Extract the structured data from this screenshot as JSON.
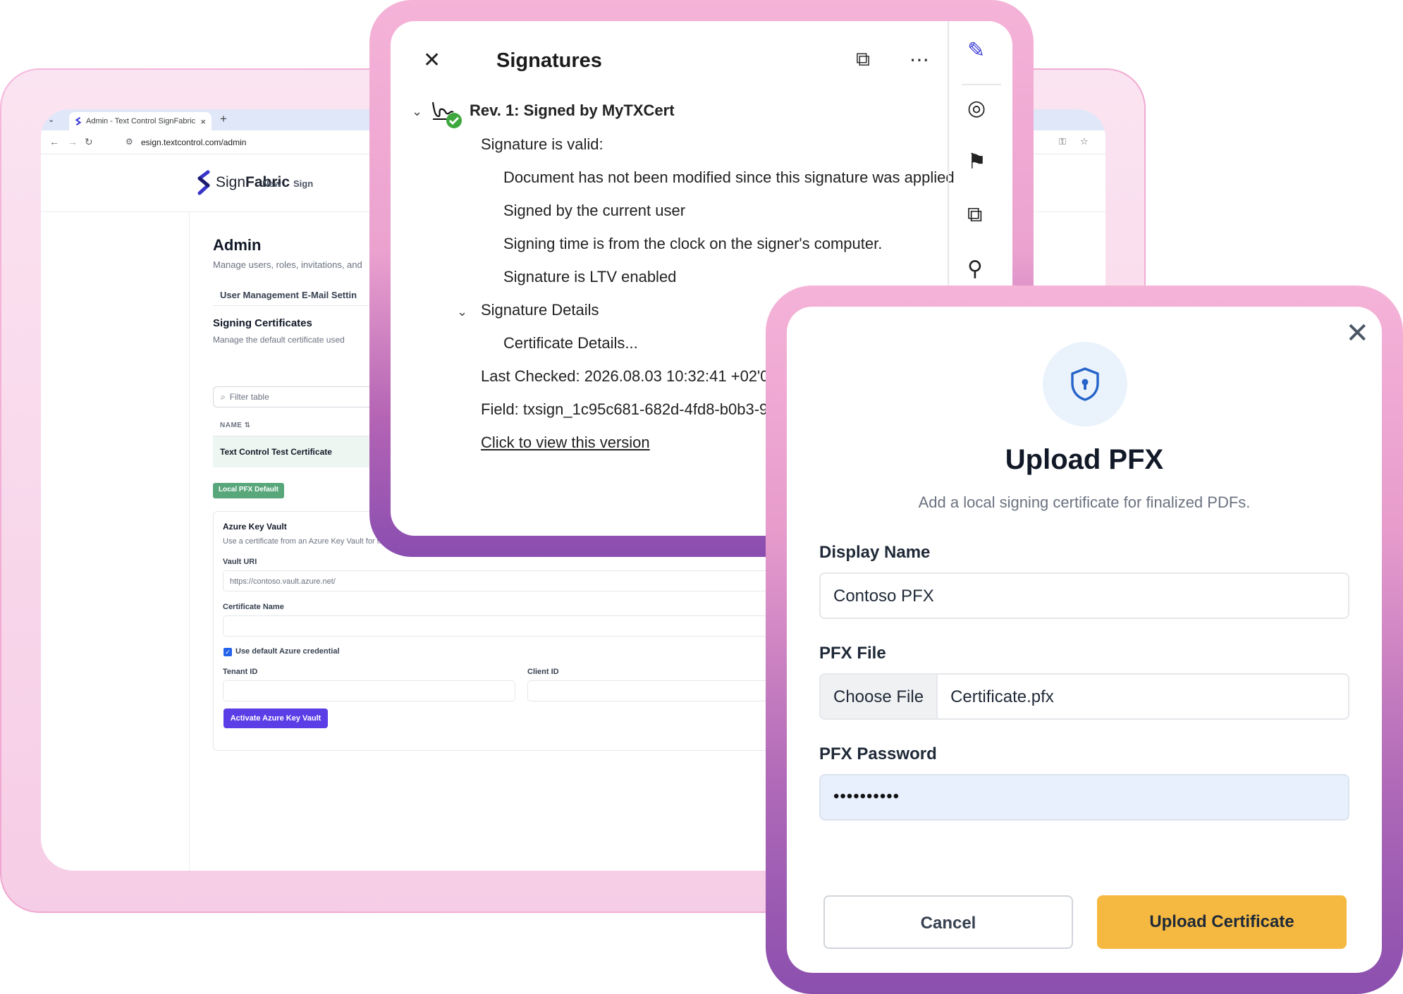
{
  "browser": {
    "tab_title": "Admin - Text Control SignFabric",
    "url": "esign.textcontrol.com/admin"
  },
  "app": {
    "logo_light": "Sign",
    "logo_bold": "Fabric",
    "nav": [
      "New",
      "Sign"
    ],
    "admin_title": "Admin",
    "admin_subtitle": "Manage users, roles, invitations, and",
    "tabs": [
      "User Management",
      "E-Mail Settin"
    ],
    "signing_certificates": {
      "title": "Signing Certificates",
      "subtitle": "Manage the default certificate used"
    },
    "filter_placeholder": "Filter table",
    "table": {
      "column_name": "NAME",
      "row_name": "Text Control Test Certificate"
    },
    "badge": "Local PFX Default",
    "azure": {
      "title": "Azure Key Vault",
      "subtitle": "Use a certificate from an Azure Key Vault for finalized PDFs.",
      "vault_uri_label": "Vault URI",
      "vault_uri_placeholder": "https://contoso.vault.azure.net/",
      "cert_name_label": "Certificate Name",
      "use_default_credential": "Use default Azure credential",
      "tenant_id_label": "Tenant ID",
      "client_id_label": "Client ID",
      "activate_button": "Activate Azure Key Vault"
    }
  },
  "signatures": {
    "title": "Signatures",
    "rev_title": "Rev. 1: Signed by MyTXCert",
    "valid": "Signature is valid:",
    "checks": [
      "Document has not been modified since this signature was applied",
      "Signed by the current user",
      "Signing time is from the clock on the signer's computer.",
      "Signature is LTV enabled"
    ],
    "details": "Signature Details",
    "cert_details": "Certificate Details...",
    "last_checked": "Last Checked: 2026.08.03 10:32:41 +02'00'",
    "field": "Field: txsign_1c95c681-682d-4fd8-b0b3-9c5b",
    "view_link": "Click to view this version"
  },
  "upload": {
    "title": "Upload PFX",
    "subtitle": "Add a local signing certificate for finalized PDFs.",
    "display_name_label": "Display Name",
    "display_name_value": "Contoso PFX",
    "pfx_file_label": "PFX File",
    "choose_file": "Choose File",
    "file_name": "Certificate.pfx",
    "password_label": "PFX Password",
    "password_value": "••••••••••",
    "cancel": "Cancel",
    "submit": "Upload Certificate"
  },
  "colors": {
    "accent_purple": "#5b3ee6",
    "badge_green": "#58a77a",
    "submit_yellow": "#f5b942",
    "frame_pink": "#f0a6d0",
    "frame_violet": "#8a4eb0"
  }
}
